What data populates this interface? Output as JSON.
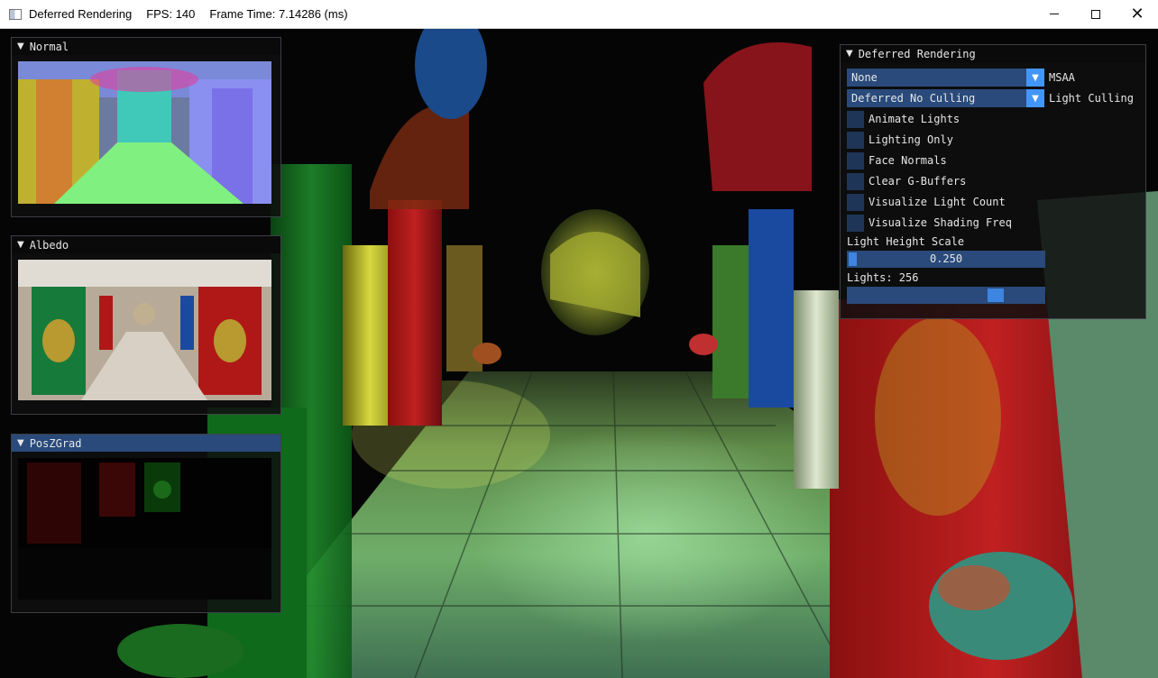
{
  "titlebar": {
    "app_title": "Deferred Rendering",
    "fps": "FPS: 140",
    "frame_time": "Frame Time: 7.14286 (ms)"
  },
  "panels": {
    "normal": {
      "title": "Normal"
    },
    "albedo": {
      "title": "Albedo"
    },
    "poszgrad": {
      "title": "PosZGrad"
    }
  },
  "settings": {
    "title": "Deferred Rendering",
    "msaa": {
      "value": "None",
      "label": "MSAA"
    },
    "light_culling": {
      "value": "Deferred No Culling",
      "label": "Light Culling"
    },
    "checkboxes": [
      {
        "label": "Animate Lights",
        "checked": false
      },
      {
        "label": "Lighting Only",
        "checked": false
      },
      {
        "label": "Face Normals",
        "checked": false
      },
      {
        "label": "Clear G-Buffers",
        "checked": false
      },
      {
        "label": "Visualize Light Count",
        "checked": false
      },
      {
        "label": "Visualize Shading Freq",
        "checked": false
      }
    ],
    "light_height_scale": {
      "label": "Light Height Scale",
      "value": "0.250",
      "fraction": 0.0
    },
    "lights": {
      "label": "Lights: 256",
      "fraction": 0.78
    }
  },
  "colors": {
    "imgui_frame": "#294a7a",
    "imgui_accent": "#4296fa",
    "imgui_title_active": "#294a7a"
  }
}
